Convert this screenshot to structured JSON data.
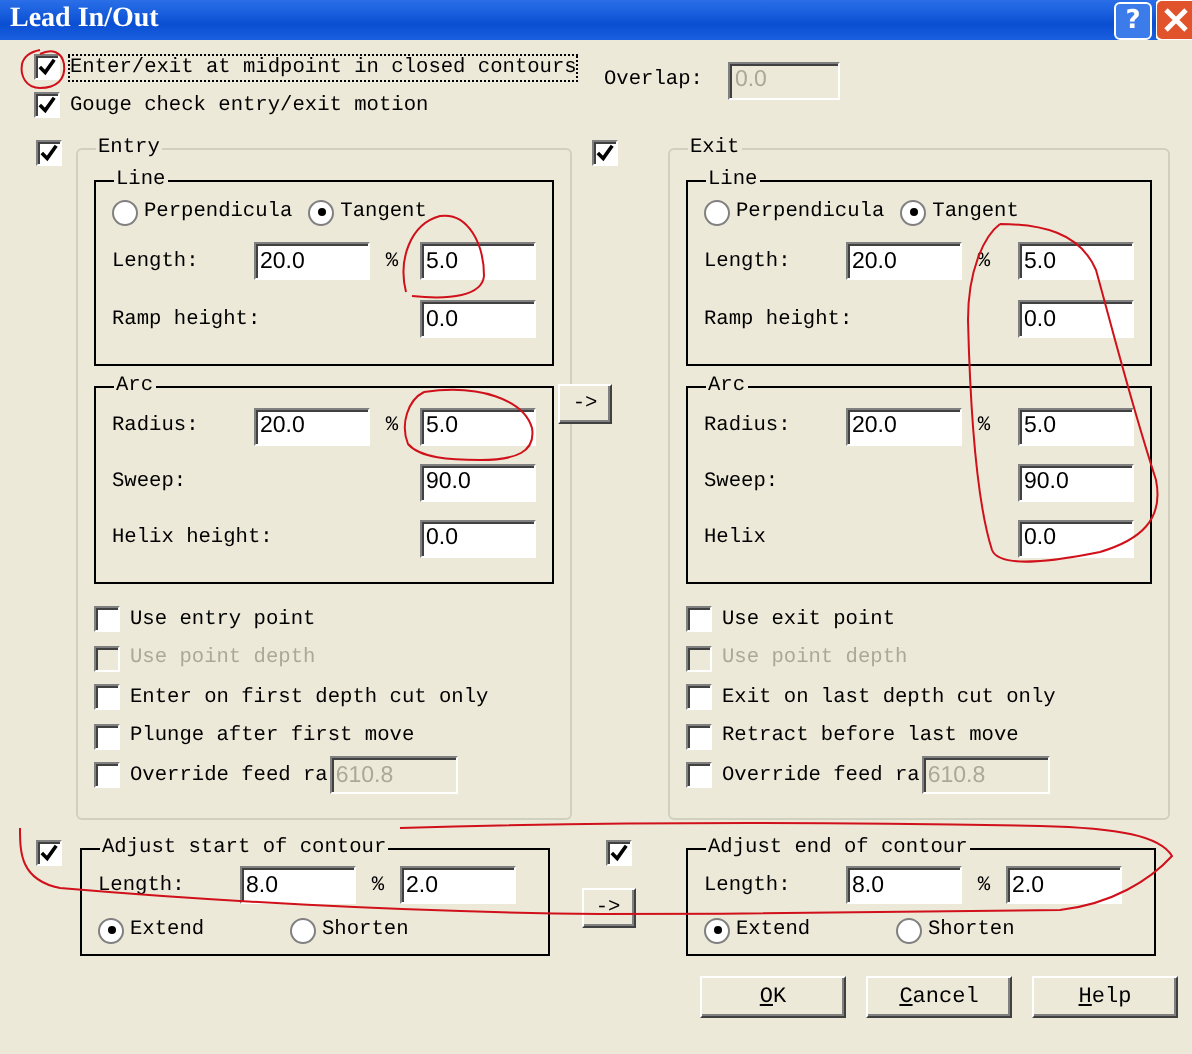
{
  "window": {
    "title": "Lead In/Out",
    "help_button": "?"
  },
  "options": [
    {
      "label": "Enter/exit at midpoint in closed contours",
      "checked": true,
      "focused": true
    },
    {
      "label": "Gouge check entry/exit motion",
      "checked": true,
      "focused": false
    }
  ],
  "overlap": {
    "label": "Overlap:",
    "value": "0.0",
    "disabled": true
  },
  "sections": [
    {
      "title": "Entry",
      "checked": true,
      "line": {
        "title": "Line",
        "modes": [
          {
            "label": "Perpendicula",
            "selected": false
          },
          {
            "label": "Tangent",
            "selected": true
          }
        ],
        "rows": [
          {
            "label": "Length:",
            "value": "20.0",
            "percent": "%",
            "value2": "5.0"
          },
          {
            "label": "Ramp height:",
            "value2": "0.0"
          }
        ]
      },
      "arc": {
        "title": "Arc",
        "rows": [
          {
            "label": "Radius:",
            "value": "20.0",
            "percent": "%",
            "value2": "5.0"
          },
          {
            "label": "Sweep:",
            "value2": "90.0"
          },
          {
            "label": "Helix height:",
            "value2": "0.0"
          }
        ]
      },
      "options": [
        {
          "label": "Use entry point",
          "checked": false,
          "disabled": false
        },
        {
          "label": "Use point depth",
          "checked": false,
          "disabled": true
        },
        {
          "label": "Enter on first depth cut only",
          "checked": false,
          "disabled": false
        },
        {
          "label": "Plunge after first move",
          "checked": false,
          "disabled": false
        },
        {
          "label": "Override feed ra",
          "checked": false,
          "disabled": false,
          "value": "610.8"
        }
      ]
    },
    {
      "title": "Exit",
      "checked": true,
      "line": {
        "title": "Line",
        "modes": [
          {
            "label": "Perpendicula",
            "selected": false
          },
          {
            "label": "Tangent",
            "selected": true
          }
        ],
        "rows": [
          {
            "label": "Length:",
            "value": "20.0",
            "percent": "%",
            "value2": "5.0"
          },
          {
            "label": "Ramp height:",
            "value2": "0.0"
          }
        ]
      },
      "arc": {
        "title": "Arc",
        "rows": [
          {
            "label": "Radius:",
            "value": "20.0",
            "percent": "%",
            "value2": "5.0"
          },
          {
            "label": "Sweep:",
            "value2": "90.0"
          },
          {
            "label": "Helix",
            "value2": "0.0"
          }
        ]
      },
      "options": [
        {
          "label": "Use exit point",
          "checked": false,
          "disabled": false
        },
        {
          "label": "Use point depth",
          "checked": false,
          "disabled": true
        },
        {
          "label": "Exit on last depth cut only",
          "checked": false,
          "disabled": false
        },
        {
          "label": "Retract before last move",
          "checked": false,
          "disabled": false
        },
        {
          "label": "Override feed ra",
          "checked": false,
          "disabled": false,
          "value": "610.8"
        }
      ]
    }
  ],
  "copy_button": "->",
  "contour": [
    {
      "title": "Adjust start of contour",
      "checked": true,
      "label": "Length:",
      "value": "8.0",
      "percent": "%",
      "value2": "2.0",
      "modes": [
        {
          "label": "Extend",
          "selected": true
        },
        {
          "label": "Shorten",
          "selected": false
        }
      ]
    },
    {
      "title": "Adjust end of contour",
      "checked": true,
      "label": "Length:",
      "value": "8.0",
      "percent": "%",
      "value2": "2.0",
      "modes": [
        {
          "label": "Extend",
          "selected": true
        },
        {
          "label": "Shorten",
          "selected": false
        }
      ]
    }
  ],
  "copy_button_2": "->",
  "buttons": [
    {
      "label": "OK"
    },
    {
      "label": "Cancel"
    },
    {
      "label": "Help"
    }
  ]
}
